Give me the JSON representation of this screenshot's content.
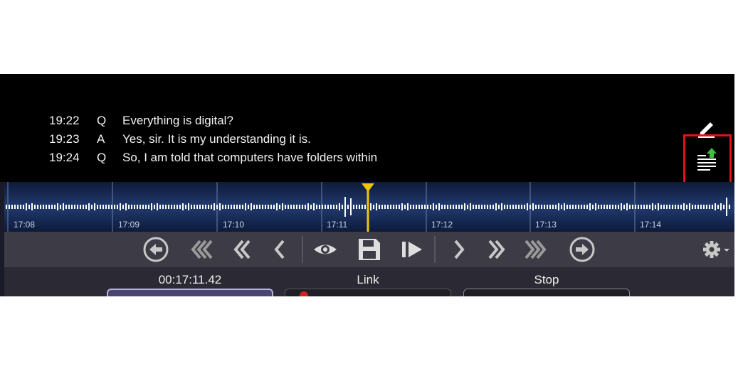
{
  "transcript": {
    "lines": [
      {
        "time": "19:22",
        "speaker": "Q",
        "text": "Everything is digital?"
      },
      {
        "time": "19:23",
        "speaker": "A",
        "text": "Yes, sir.  It is my understanding it is."
      },
      {
        "time": "19:24",
        "speaker": "Q",
        "text": "So, I am told that computers have folders within"
      }
    ],
    "edit_icon": "pencil-icon",
    "import_icon": "import-transcript-icon"
  },
  "waveform": {
    "ticks": [
      "17:08",
      "17:09",
      "17:10",
      "17:11",
      "17:12",
      "17:13",
      "17:14"
    ],
    "playhead_color": "#f2c500",
    "wave_color": "#ffffff"
  },
  "controls": {
    "buttons": [
      "go-to-start",
      "rewind-fast",
      "rewind",
      "step-back",
      "view",
      "save",
      "play-from",
      "step-forward",
      "forward",
      "forward-fast",
      "go-to-end"
    ],
    "settings_icon": "gear-icon"
  },
  "bottom": {
    "time_value": "00:17:11.42",
    "link_label": "Link",
    "stop_label": "Stop"
  },
  "colors": {
    "highlight": "#e0141a",
    "accent_green": "#3fbf3f",
    "controls_bg": "#3d3b45"
  }
}
